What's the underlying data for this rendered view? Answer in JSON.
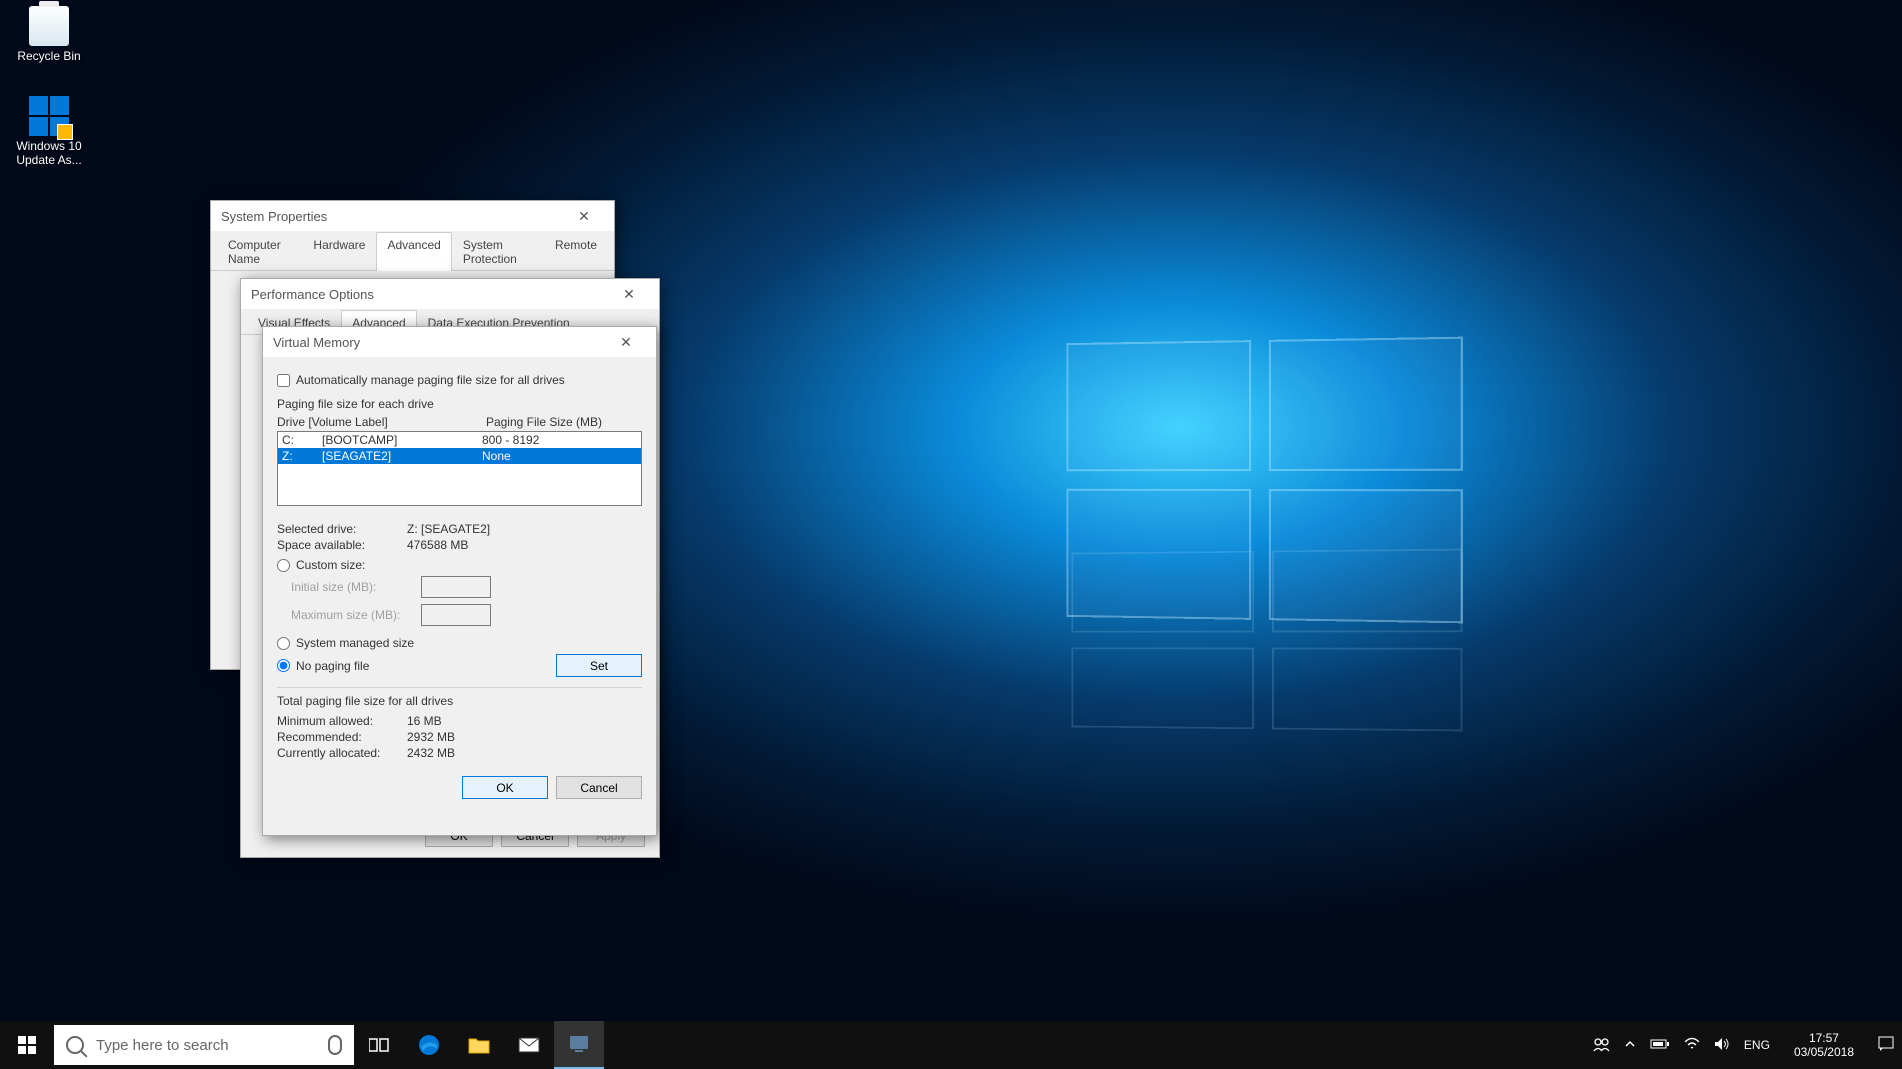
{
  "desktop": {
    "icons": [
      {
        "label": "Recycle Bin"
      },
      {
        "label": "Windows 10 Update As..."
      }
    ]
  },
  "sysprops": {
    "title": "System Properties",
    "tabs": [
      "Computer Name",
      "Hardware",
      "Advanced",
      "System Protection",
      "Remote"
    ],
    "active_tab": 2
  },
  "perfopts": {
    "title": "Performance Options",
    "tabs": [
      "Visual Effects",
      "Advanced",
      "Data Execution Prevention"
    ],
    "active_tab": 1,
    "buttons": {
      "ok": "OK",
      "cancel": "Cancel",
      "apply": "Apply"
    }
  },
  "vmem": {
    "title": "Virtual Memory",
    "auto_manage_label": "Automatically manage paging file size for all drives",
    "auto_manage_checked": false,
    "section_label": "Paging file size for each drive",
    "headers": {
      "drive": "Drive  [Volume Label]",
      "size": "Paging File Size (MB)"
    },
    "drives": [
      {
        "letter": "C:",
        "label": "[BOOTCAMP]",
        "size": "800 - 8192",
        "selected": false
      },
      {
        "letter": "Z:",
        "label": "[SEAGATE2]",
        "size": "None",
        "selected": true
      }
    ],
    "selected_drive_label": "Selected drive:",
    "selected_drive_value": "Z:  [SEAGATE2]",
    "space_label": "Space available:",
    "space_value": "476588 MB",
    "option_custom": "Custom size:",
    "initial_label": "Initial size (MB):",
    "maximum_label": "Maximum size (MB):",
    "option_system": "System managed size",
    "option_none": "No paging file",
    "selected_option": "none",
    "set_btn": "Set",
    "totals_title": "Total paging file size for all drives",
    "min_label": "Minimum allowed:",
    "min_value": "16 MB",
    "rec_label": "Recommended:",
    "rec_value": "2932 MB",
    "cur_label": "Currently allocated:",
    "cur_value": "2432 MB",
    "buttons": {
      "ok": "OK",
      "cancel": "Cancel"
    }
  },
  "taskbar": {
    "search_placeholder": "Type here to search",
    "lang": "ENG",
    "time": "17:57",
    "date": "03/05/2018"
  }
}
